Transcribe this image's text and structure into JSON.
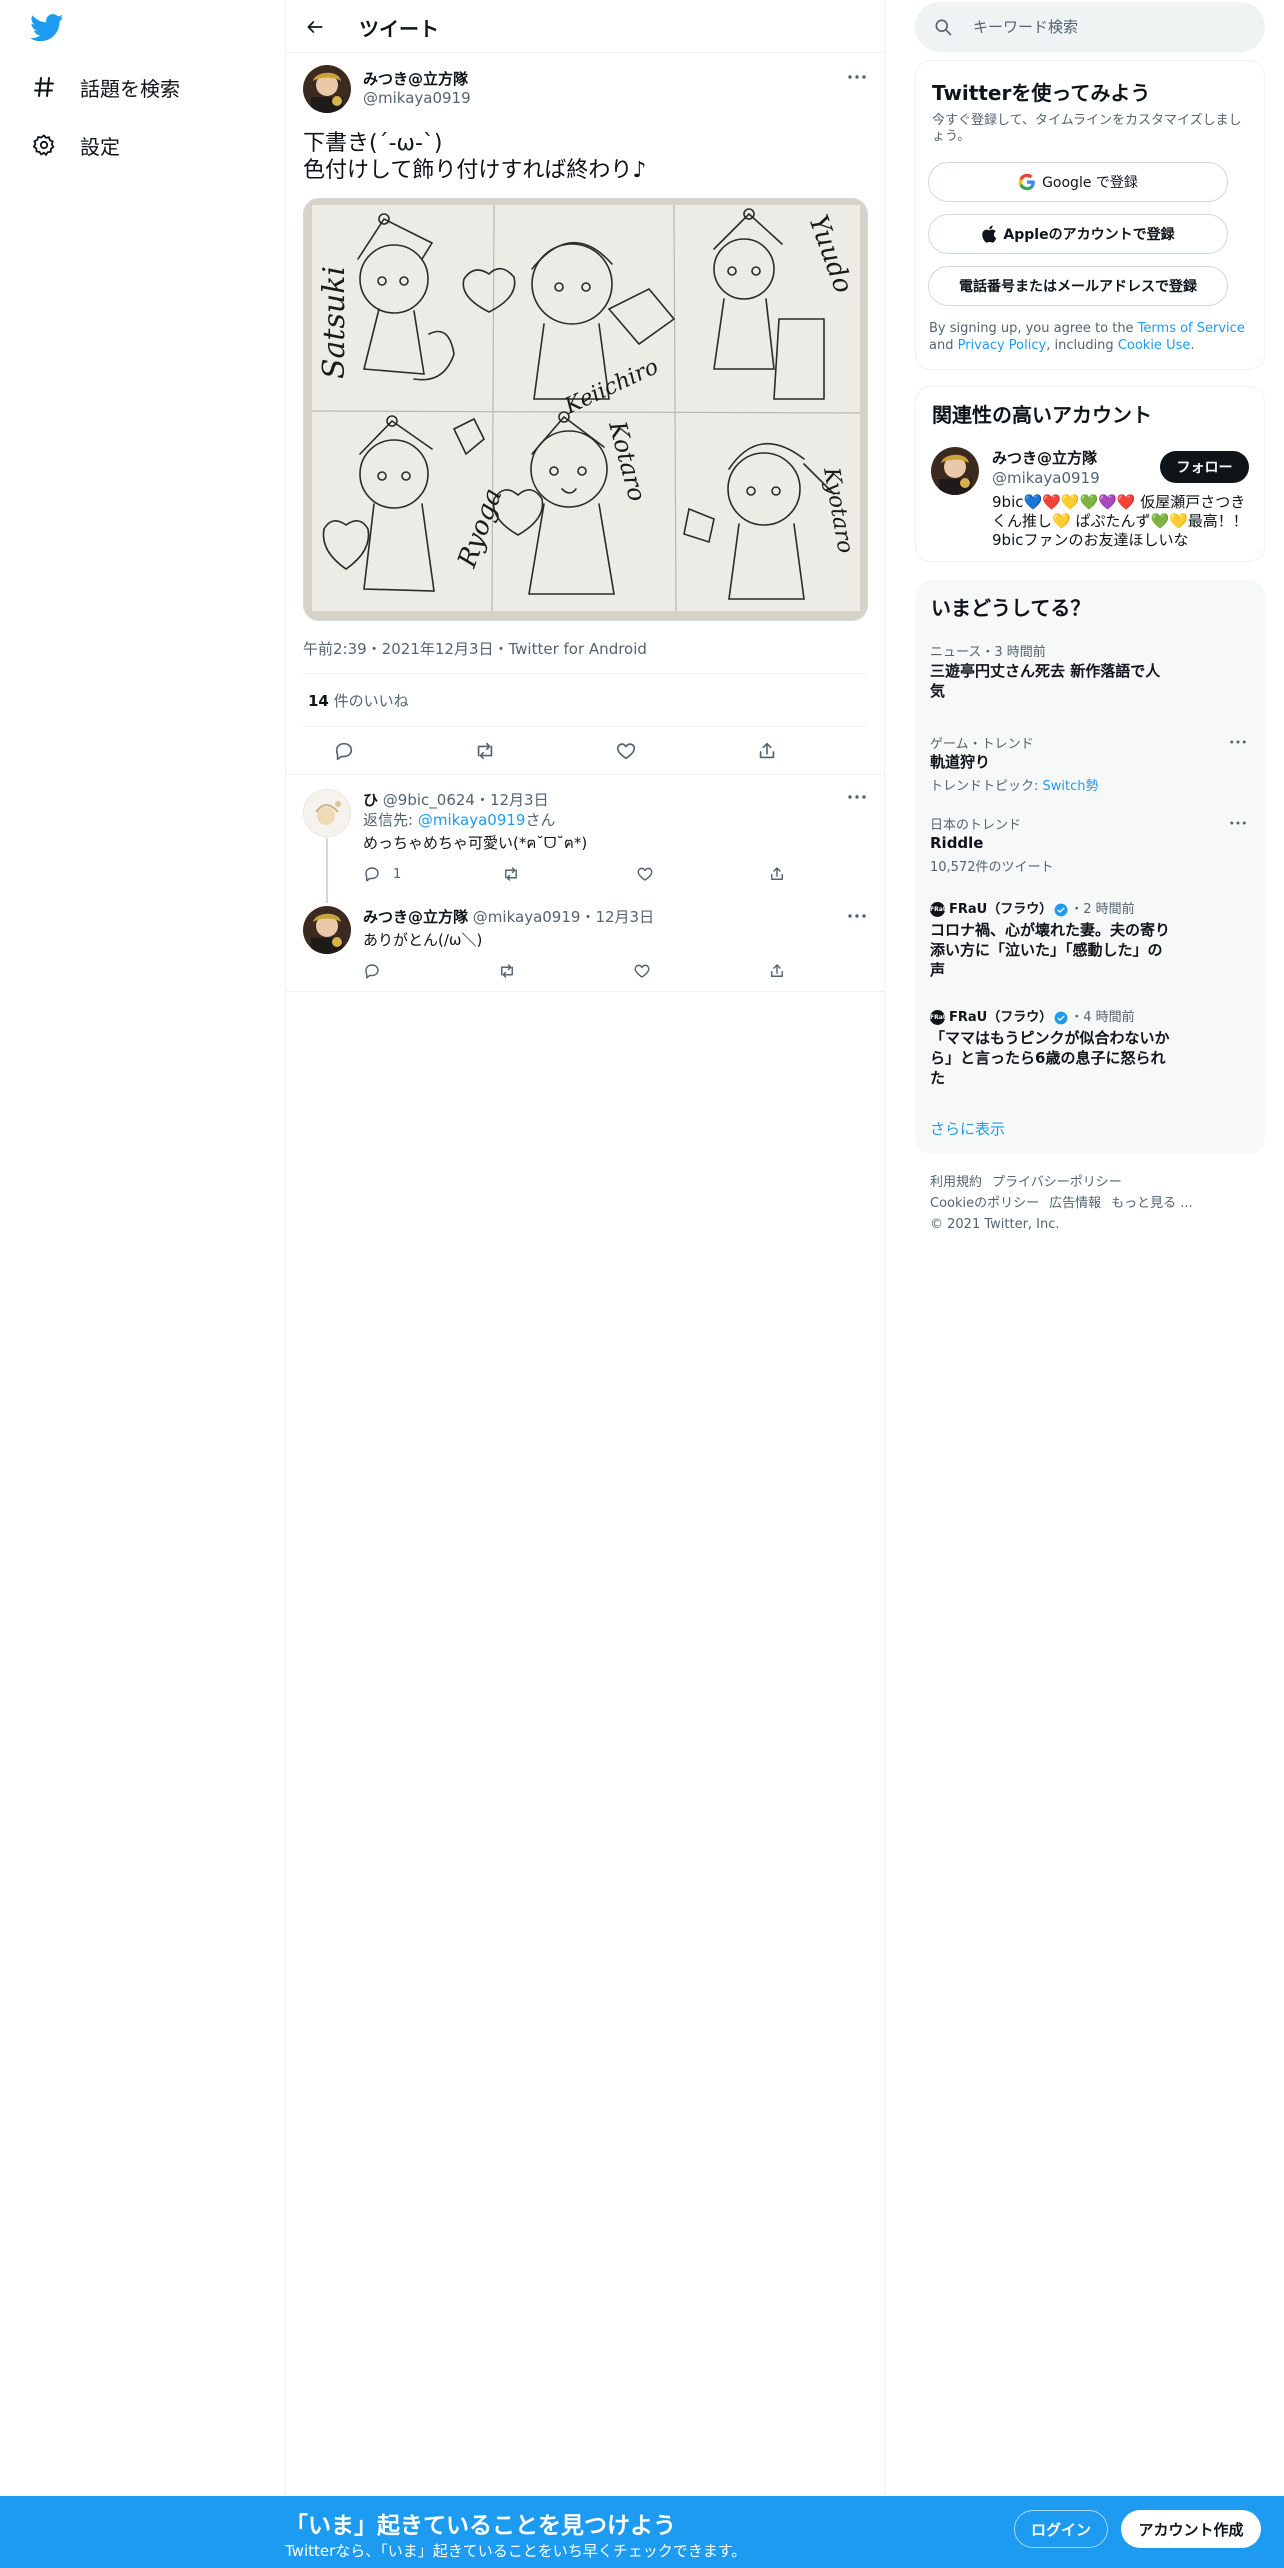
{
  "nav": {
    "explore_label": "話題を検索",
    "settings_label": "設定"
  },
  "header": {
    "title": "ツイート"
  },
  "tweet": {
    "author_name": "みつき@立方隊",
    "author_handle": "@mikaya0919",
    "text_line1": "下書き(´-ω-`)",
    "text_line2": "色付けして飾り付けすれば終わり♪",
    "meta": "午前2:39・2021年12月3日・Twitter for Android",
    "likes_count": "14",
    "likes_label": " 件のいいね",
    "drawing_signatures": [
      "Satsuki",
      "Keiichiro",
      "Yuudo",
      "Ryoga",
      "Kotaro",
      "Kyotaro"
    ]
  },
  "replies": [
    {
      "name": "ひ",
      "handle": "@9bic_0624",
      "date": "12月3日",
      "reply_to_prefix": "返信先: ",
      "reply_to_handle": "@mikaya0919",
      "reply_to_suffix": "さん",
      "text": "めっちゃめちゃ可愛い(*ฅ˘ᗜ˘ฅ*)",
      "reply_count": "1"
    },
    {
      "name": "みつき@立方隊",
      "handle": "@mikaya0919",
      "date": "12月3日",
      "text": "ありがとん(/ω＼)"
    }
  ],
  "search": {
    "placeholder": "キーワード検索"
  },
  "signup": {
    "title": "Twitterを使ってみよう",
    "subtitle": "今すぐ登録して、タイムラインをカスタマイズしましょう。",
    "google_label": "Google で登録",
    "apple_label": "Appleのアカウントで登録",
    "phone_label": "電話番号またはメールアドレスで登録",
    "legal_prefix": "By signing up, you agree to the ",
    "tos": "Terms of Service",
    "and": " and ",
    "privacy": "Privacy Policy",
    "including": ", including ",
    "cookie": "Cookie Use",
    "period": "."
  },
  "relevant": {
    "title": "関連性の高いアカウント",
    "name": "みつき@立方隊",
    "handle": "@mikaya0919",
    "follow_label": "フォロー",
    "bio": "9bic💙❤️💛💚💜❤️ 仮屋瀬戸さつきくん推し💛 ぱぷたんず💚💛最高！！9bicファンのお友達ほしいな"
  },
  "trends": {
    "title": "いまどうしてる？",
    "items": [
      {
        "category": "ニュース・3 時間前",
        "title": "三遊亭円丈さん死去 新作落語で人気"
      },
      {
        "category": "ゲーム・トレンド",
        "title": "軌道狩り",
        "sub_prefix": "トレンドトピック: ",
        "sub_link": "Switch勢"
      },
      {
        "category": "日本のトレンド",
        "title": "Riddle",
        "sub": "10,572件のツイート"
      },
      {
        "source": "FRaU（フラウ）",
        "time": "・2 時間前",
        "title": "コロナ禍、心が壊れた妻。夫の寄り添い方に「泣いた」「感動した」の声"
      },
      {
        "source": "FRaU（フラウ）",
        "time": "・4 時間前",
        "title": "「ママはもうピンクが似合わないから」と言ったら6歳の息子に怒られた"
      }
    ],
    "show_more": "さらに表示"
  },
  "footer": {
    "links": [
      "利用規約",
      "プライバシーポリシー",
      "Cookieのポリシー",
      "広告情報",
      "もっと見る ..."
    ],
    "copyright": "© 2021 Twitter, Inc."
  },
  "banner": {
    "title": "「いま」起きていることを見つけよう",
    "subtitle": "Twitterなら、「いま」起きていることをいち早くチェックできます。",
    "login_label": "ログイン",
    "signup_label": "アカウント作成"
  },
  "colors": {
    "accent": "#1d9bf0",
    "text": "#0f1419",
    "muted": "#536471"
  }
}
